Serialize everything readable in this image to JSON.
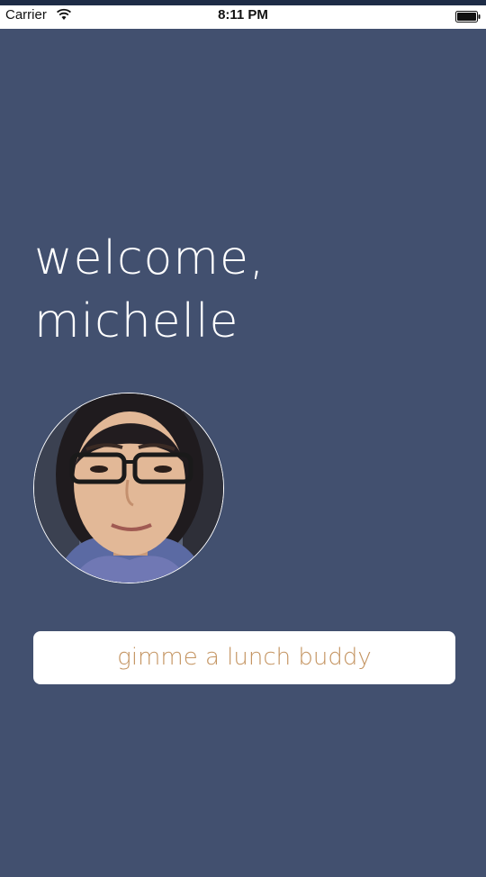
{
  "status_bar": {
    "carrier": "Carrier",
    "time": "8:11 PM",
    "wifi_icon": "wifi-icon",
    "battery_icon": "battery-icon"
  },
  "welcome": {
    "line1": "welcome,",
    "line2": "michelle"
  },
  "avatar": {
    "icon": "profile-photo"
  },
  "cta_button": {
    "label": "gimme a lunch buddy"
  },
  "colors": {
    "background": "#42506f",
    "button_bg": "#ffffff",
    "button_text": "#c49461",
    "heading_text": "#ffffff"
  }
}
